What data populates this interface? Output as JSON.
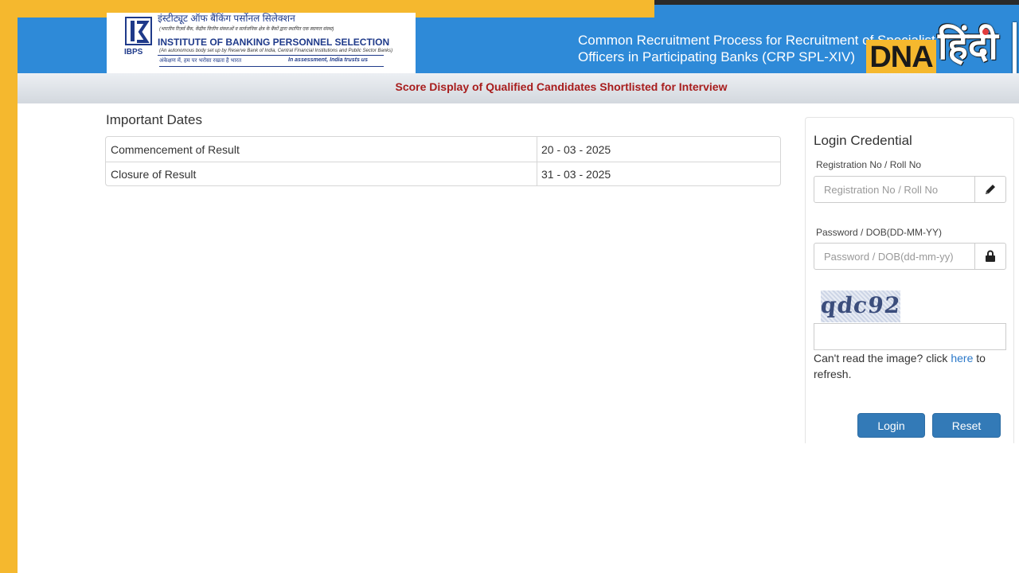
{
  "header": {
    "logo": {
      "hindi_name": "इंस्टीट्यूट ऑफ बैंकिंग पर्सोनल सिलेक्शन",
      "hindi_subtitle": "(भारतीय रिज़र्व बैंक, केंद्रीय वित्तीय संस्थाओं व सार्वजनिक क्षेत्र के बैंकों द्वारा स्थापित एक स्वायत्त संस्था)",
      "english_name": "INSTITUTE OF BANKING PERSONNEL SELECTION",
      "english_subtitle": "(An autonomous body set up by Reserve Bank of India, Central Financial Institutions and Public Sector Banks)",
      "motto_hindi": "अंकेक्षण में, हम पर भरोसा रखता है भारत",
      "motto_english": "In assessment, India trusts us",
      "short_name": "IBPS"
    },
    "title_line1": "Common Recruitment Process for Recruitment of Specialist",
    "title_line2": "Officers in Participating Banks (CRP SPL-XIV)",
    "watermark": {
      "en": "DNA",
      "hi": "हिंदी"
    }
  },
  "subheader": {
    "text": "Score Display of Qualified Candidates Shortlisted for Interview"
  },
  "important_dates": {
    "heading": "Important Dates",
    "rows": [
      {
        "label": "Commencement of Result",
        "value": "20 - 03 - 2025"
      },
      {
        "label": "Closure of Result",
        "value": "31 - 03 - 2025"
      }
    ]
  },
  "login": {
    "title": "Login Credential",
    "registration_label": "Registration No / Roll No",
    "registration_placeholder": "Registration No / Roll No",
    "registration_icon": "pencil-icon",
    "password_label": "Password / DOB(DD-MM-YY)",
    "password_placeholder": "Password / DOB(dd-mm-yy)",
    "password_icon": "lock-icon",
    "captcha_text": "qdc92",
    "refresh_prefix": "Can't read the image? click ",
    "refresh_link": "here",
    "refresh_suffix": " to refresh.",
    "login_button": "Login",
    "reset_button": "Reset"
  },
  "colors": {
    "header_blue": "#2e8ad8",
    "frame_yellow": "#f5b82e",
    "subheader_red": "#a81d1d",
    "button_blue": "#337ab7",
    "link_blue": "#2a78c9"
  }
}
